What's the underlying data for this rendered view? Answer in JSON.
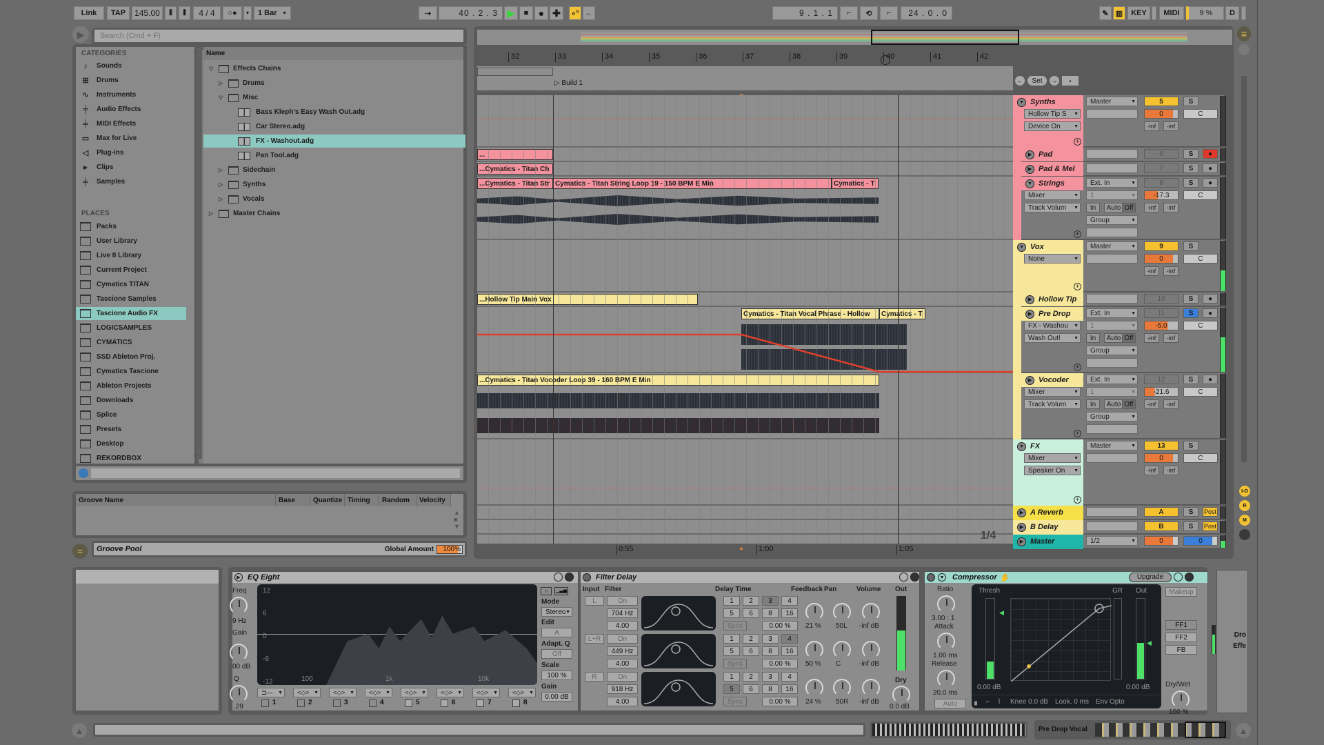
{
  "transport": {
    "link": "Link",
    "tap": "TAP",
    "tempo": "145.00",
    "time_signature": "4 / 4",
    "metronome_icon": "metronome-icon",
    "quantization": "1 Bar",
    "arrangement_position": "40 .  2 .  3",
    "loop_start": "9 .  1 .  1",
    "loop_length": "24 .  0 .  0",
    "key_label": "KEY",
    "midi_label": "MIDI",
    "cpu_load": "9 %",
    "d_label": "D"
  },
  "browser": {
    "search_placeholder": "Search (Cmd + F)",
    "categories_header": "CATEGORIES",
    "categories": [
      {
        "label": "Sounds",
        "icon": "♪"
      },
      {
        "label": "Drums",
        "icon": "⊞"
      },
      {
        "label": "Instruments",
        "icon": "∿"
      },
      {
        "label": "Audio Effects",
        "icon": "╪"
      },
      {
        "label": "MIDI Effects",
        "icon": "╪"
      },
      {
        "label": "Max for Live",
        "icon": "▭"
      },
      {
        "label": "Plug-ins",
        "icon": "◁"
      },
      {
        "label": "Clips",
        "icon": "▸"
      },
      {
        "label": "Samples",
        "icon": "╪"
      }
    ],
    "places_header": "PLACES",
    "places": [
      {
        "label": "Packs"
      },
      {
        "label": "User Library"
      },
      {
        "label": "Live 8 Library"
      },
      {
        "label": "Current Project"
      },
      {
        "label": "Cymatics TITAN"
      },
      {
        "label": "Tascione Samples"
      },
      {
        "label": "Tascione Audio FX",
        "selected": true
      },
      {
        "label": "LOGICSAMPLES"
      },
      {
        "label": "CYMATICS"
      },
      {
        "label": "SSD Ableton Proj."
      },
      {
        "label": "Cymatics Tascione"
      },
      {
        "label": "Ableton Projects"
      },
      {
        "label": "Downloads"
      },
      {
        "label": "Splice"
      },
      {
        "label": "Presets"
      },
      {
        "label": "Desktop"
      },
      {
        "label": "REKORDBOX"
      }
    ],
    "name_header": "Name",
    "tree": [
      {
        "label": "Effects Chains",
        "depth": 0,
        "type": "folder",
        "open": true
      },
      {
        "label": "Drums",
        "depth": 1,
        "type": "folder",
        "open": false
      },
      {
        "label": "Misc",
        "depth": 1,
        "type": "folder",
        "open": true
      },
      {
        "label": "Bass Kleph's Easy Wash Out.adg",
        "depth": 2,
        "type": "file"
      },
      {
        "label": "Car Stereo.adg",
        "depth": 2,
        "type": "file"
      },
      {
        "label": "FX - Washout.adg",
        "depth": 2,
        "type": "file",
        "selected": true
      },
      {
        "label": "Pan Tool.adg",
        "depth": 2,
        "type": "file"
      },
      {
        "label": "Sidechain",
        "depth": 1,
        "type": "folder",
        "open": false
      },
      {
        "label": "Synths",
        "depth": 1,
        "type": "folder",
        "open": false
      },
      {
        "label": "Vocals",
        "depth": 1,
        "type": "folder",
        "open": false
      },
      {
        "label": "Master Chains",
        "depth": 0,
        "type": "folder",
        "open": false
      }
    ]
  },
  "groove": {
    "columns": [
      "Groove Name",
      "Base",
      "Quantize",
      "Timing",
      "Random",
      "Velocity"
    ],
    "title": "Groove Pool",
    "global_amount_label": "Global Amount",
    "global_amount": "100%"
  },
  "arrangement": {
    "bars": [
      "32",
      "33",
      "34",
      "35",
      "36",
      "37",
      "38",
      "39",
      "40",
      "41",
      "42"
    ],
    "locator": "Build 1",
    "time_ticks": [
      "0:55",
      "1:00",
      "1:05"
    ],
    "zoom_fraction": "1/4",
    "set_label": "Set",
    "clips": [
      {
        "track": "pad",
        "label": "..."
      },
      {
        "track": "padmel",
        "label": "...Cymatics - Titan Ch"
      },
      {
        "track": "strings",
        "label": "...Cymatics - Titan Str"
      },
      {
        "track": "strings",
        "label": "Cymatics - Titan String Loop 19 - 150 BPM E Min"
      },
      {
        "track": "strings",
        "label": "Cymatics - T"
      },
      {
        "track": "hollowtip",
        "label": "...Hollow Tip Main Vox"
      },
      {
        "track": "predrop",
        "label": "Cymatics - Titan Vocal Phrase - Hollow"
      },
      {
        "track": "predrop",
        "label": "Cymatics - T"
      },
      {
        "track": "vocoder",
        "label": "...Cymatics - Titan Vocoder Loop 39 - 160 BPM E Min"
      }
    ]
  },
  "tracks": [
    {
      "name": "Synths",
      "color": "#f4929d",
      "group": true,
      "io1": "Master",
      "num": "5",
      "num_on": true,
      "vol": "0",
      "pan": "C",
      "dev": "Hollow Tip S",
      "param": "Device On",
      "send1": "-inf",
      "send2": "-inf"
    },
    {
      "name": "Pad",
      "color": "#f4929d",
      "io1": "",
      "num": "6",
      "solo": "S",
      "arm": "armed"
    },
    {
      "name": "Pad & Mel",
      "color": "#f4929d",
      "io1": "",
      "num": "7",
      "solo": "S",
      "arm": "rec"
    },
    {
      "name": "Strings",
      "color": "#f4929d",
      "group": true,
      "io1": "Ext. In",
      "io2": "1",
      "mon": [
        "In",
        "Auto",
        "Off"
      ],
      "out": "Group",
      "num": "8",
      "vol": "-17.3",
      "pan": "C",
      "dev": "Mixer",
      "param": "Track Volum",
      "send1": "-inf",
      "send2": "-inf"
    },
    {
      "name": "Vox",
      "color": "#f6e79a",
      "group": true,
      "io1": "Master",
      "num": "9",
      "num_on": true,
      "vol": "0",
      "pan": "C",
      "dev": "None",
      "send1": "-inf",
      "send2": "-inf"
    },
    {
      "name": "Hollow Tip",
      "color": "#f6e79a",
      "num": "10"
    },
    {
      "name": "Pre Drop",
      "color": "#f6e79a",
      "io1": "Ext. In",
      "io2": "1",
      "mon": [
        "In",
        "Auto",
        "Off"
      ],
      "out": "Group",
      "num": "11",
      "solo_active": true,
      "vol": "-5.0",
      "pan": "C",
      "dev": "FX - Washou",
      "param": "Wash Out!",
      "send1": "-inf",
      "send2": "-inf"
    },
    {
      "name": "Vocoder",
      "color": "#f6e79a",
      "io1": "Ext. In",
      "io2": "1",
      "mon": [
        "In",
        "Auto",
        "Off"
      ],
      "out": "Group",
      "num": "12",
      "vol": "-21.6",
      "pan": "C",
      "dev": "Mixer",
      "param": "Track Volum",
      "send1": "-inf",
      "send2": "-inf"
    },
    {
      "name": "FX",
      "color": "#c8f0dc",
      "io1": "Master",
      "num": "13",
      "num_on": true,
      "vol": "0",
      "pan": "C",
      "dev": "Mixer",
      "param": "Speaker On",
      "send1": "-inf",
      "send2": "-inf"
    },
    {
      "name": "A Reverb",
      "color": "#f6e04a",
      "num": "A",
      "post": "Post"
    },
    {
      "name": "B Delay",
      "color": "#f6e79a",
      "num": "B",
      "post": "Post"
    },
    {
      "name": "Master",
      "color": "#1fb5a8",
      "io1": "1/2",
      "vol": "0",
      "vol2": "0"
    }
  ],
  "side_buttons": [
    "I-O",
    "R",
    "M"
  ],
  "eq": {
    "title": "EQ Eight",
    "freq_label": "Freq",
    "freq_value": "9 Hz",
    "gain_label": "Gain",
    "gain_value": "00 dB",
    "q_label": "Q",
    "q_value": ".29",
    "db_ticks": [
      "12",
      "6",
      "0",
      "-6",
      "-12"
    ],
    "freq_ticks": [
      "100",
      "1k",
      "10k"
    ],
    "bands": [
      "1",
      "2",
      "3",
      "4",
      "5",
      "6",
      "7",
      "8"
    ],
    "mode_label": "Mode",
    "mode_value": "Stereo",
    "edit_label": "Edit",
    "edit_value": "A",
    "adaptq_label": "Adapt. Q",
    "adaptq_value": "Off",
    "scale_label": "Scale",
    "scale_value": "100 %",
    "gain2_label": "Gain",
    "gain2_value": "0.00 dB"
  },
  "filter_delay": {
    "title": "Filter Delay",
    "input_label": "Input",
    "filter_label": "Filter",
    "delay_time_label": "Delay Time",
    "feedback_label": "Feedback",
    "pan_label": "Pan",
    "volume_label": "Volume",
    "out_label": "Out",
    "dry_label": "Dry",
    "dry_value": "0.0 dB",
    "on_label": "On",
    "sync_label": "Sync",
    "beat_buttons": [
      "1",
      "2",
      "3",
      "4",
      "5",
      "6",
      "8",
      "16"
    ],
    "rows": [
      {
        "input": "L",
        "freq": "704 Hz",
        "q": "4.00",
        "offset": "0.00 %",
        "feedback": "21 %",
        "pan": "50L",
        "volume": "-inf dB",
        "active_beat": "3"
      },
      {
        "input": "L+R",
        "freq": "449 Hz",
        "q": "4.00",
        "offset": "0.00 %",
        "feedback": "50 %",
        "pan": "C",
        "volume": "-inf dB",
        "active_beat": "4"
      },
      {
        "input": "R",
        "freq": "918 Hz",
        "q": "4.00",
        "offset": "0.00 %",
        "feedback": "24 %",
        "pan": "50R",
        "volume": "-inf dB",
        "active_beat": "5"
      }
    ]
  },
  "compressor": {
    "title": "Compressor",
    "upgrade": "Upgrade",
    "ratio_label": "Ratio",
    "ratio_value": "3.00 : 1",
    "attack_label": "Attack",
    "attack_value": "1.00 ms",
    "release_label": "Release",
    "release_value": "20.0 ms",
    "auto_label": "Auto",
    "thresh_label": "Thresh",
    "thresh_value": "0.00 dB",
    "gr_label": "GR",
    "out_label": "Out",
    "out_value": "0.00 dB",
    "knee": "Knee 0.0 dB",
    "look": "Look. 0 ms",
    "env": "Env Opto",
    "makeup_label": "Makeup",
    "modes": [
      "FF1",
      "FF2",
      "FB"
    ],
    "drywet_label": "Dry/Wet",
    "drywet_value": "100 %"
  },
  "rack_partial": {
    "line1": "Dro",
    "line2": "Effe"
  },
  "status": {
    "track_name": "Pre Drop Vocal"
  }
}
